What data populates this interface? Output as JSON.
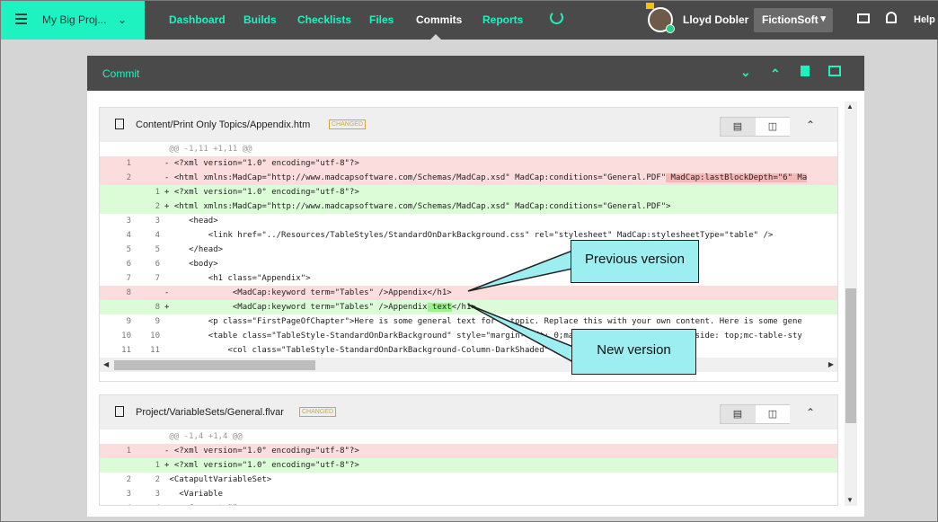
{
  "header": {
    "project_name": "My Big Proj...",
    "nav": [
      "Dashboard",
      "Builds",
      "Checklists",
      "Files",
      "Commits",
      "Reports"
    ],
    "active_nav": "Commits",
    "user_name": "Lloyd Dobler",
    "org_name": "FictionSoft",
    "help_label": "Help"
  },
  "commit": {
    "title": "Commit"
  },
  "files": [
    {
      "path": "Content/Print Only Topics/Appendix.htm",
      "badge": "CHANGED",
      "lines": [
        {
          "type": "hunk",
          "n1": "",
          "n2": "",
          "prefix": "",
          "text": "@@ -1,11 +1,11 @@"
        },
        {
          "type": "del",
          "n1": "1",
          "n2": "",
          "prefix": "-",
          "text": "<?xml version=\"1.0\" encoding=\"utf-8\"?>"
        },
        {
          "type": "del",
          "n1": "2",
          "n2": "",
          "prefix": "-",
          "text": "<html xmlns:MadCap=\"http://www.madcapsoftware.com/Schemas/MadCap.xsd\" MadCap:conditions=\"General.PDF\"",
          "hl": " MadCap:lastBlockDepth=\"6\" Ma"
        },
        {
          "type": "add",
          "n1": "",
          "n2": "1",
          "prefix": "+",
          "text": "<?xml version=\"1.0\" encoding=\"utf-8\"?>"
        },
        {
          "type": "add",
          "n1": "",
          "n2": "2",
          "prefix": "+",
          "text": "<html xmlns:MadCap=\"http://www.madcapsoftware.com/Schemas/MadCap.xsd\" MadCap:conditions=\"General.PDF\">"
        },
        {
          "type": "ctx",
          "n1": "3",
          "n2": "3",
          "prefix": "",
          "text": "    <head>"
        },
        {
          "type": "ctx",
          "n1": "4",
          "n2": "4",
          "prefix": "",
          "text": "        <link href=\"../Resources/TableStyles/StandardOnDarkBackground.css\" rel=\"stylesheet\" MadCap:stylesheetType=\"table\" />"
        },
        {
          "type": "ctx",
          "n1": "5",
          "n2": "5",
          "prefix": "",
          "text": "    </head>"
        },
        {
          "type": "ctx",
          "n1": "6",
          "n2": "6",
          "prefix": "",
          "text": "    <body>"
        },
        {
          "type": "ctx",
          "n1": "7",
          "n2": "7",
          "prefix": "",
          "text": "        <h1 class=\"Appendix\">"
        },
        {
          "type": "del",
          "n1": "8",
          "n2": "",
          "prefix": "-",
          "text": "            <MadCap:keyword term=\"Tables\" />Appendix</h1>"
        },
        {
          "type": "add",
          "n1": "",
          "n2": "8",
          "prefix": "+",
          "text": "            <MadCap:keyword term=\"Tables\" />Appendix",
          "hl": " text",
          "after": "</h1>"
        },
        {
          "type": "ctx",
          "n1": "9",
          "n2": "9",
          "prefix": "",
          "text": "        <p class=\"FirstPageOfChapter\">Here is some general text for a topic. Replace this with your own content. Here is some gene"
        },
        {
          "type": "ctx",
          "n1": "10",
          "n2": "10",
          "prefix": "",
          "text": "        <table class=\"TableStyle-StandardOnDarkBackground\" style=\"margin-left: 0;margin-right: auto;caption-side: top;mc-table-sty"
        },
        {
          "type": "ctx",
          "n1": "11",
          "n2": "11",
          "prefix": "",
          "text": "            <col class=\"TableStyle-StandardOnDarkBackground-Column-DarkShaded\" />"
        }
      ]
    },
    {
      "path": "Project/VariableSets/General.flvar",
      "badge": "CHANGED",
      "lines": [
        {
          "type": "hunk",
          "n1": "",
          "n2": "",
          "prefix": "",
          "text": "@@ -1,4 +1,4 @@"
        },
        {
          "type": "del",
          "n1": "1",
          "n2": "",
          "prefix": "-",
          "text": "<?xml version=\"1.0\" encoding=\"utf-8\"?>"
        },
        {
          "type": "add",
          "n1": "",
          "n2": "1",
          "prefix": "+",
          "text": "<?xml version=\"1.0\" encoding=\"utf-8\"?>"
        },
        {
          "type": "ctx",
          "n1": "2",
          "n2": "2",
          "prefix": "",
          "text": "<CatapultVariableSet>"
        },
        {
          "type": "ctx",
          "n1": "3",
          "n2": "3",
          "prefix": "",
          "text": "  <Variable"
        },
        {
          "type": "ctx",
          "n1": "4",
          "n2": "4",
          "prefix": "",
          "text": "    Comment=\"\""
        }
      ]
    }
  ],
  "callouts": {
    "previous": "Previous version",
    "new": "New version"
  }
}
